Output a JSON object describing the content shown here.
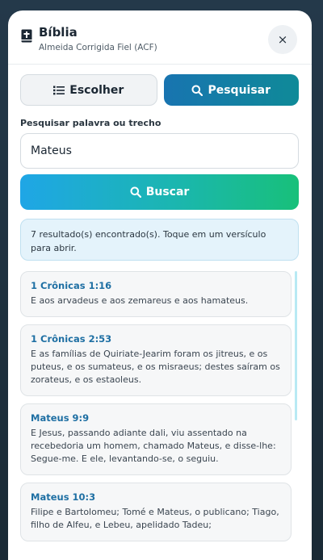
{
  "header": {
    "title": "Bíblia",
    "subtitle": "Almeida Corrigida Fiel (ACF)",
    "close_label": "×"
  },
  "tabs": {
    "choose_label": "Escolher",
    "search_label": "Pesquisar",
    "active": "Pesquisar"
  },
  "search": {
    "label": "Pesquisar palavra ou trecho",
    "value": "Mateus",
    "button_label": "Buscar"
  },
  "info": {
    "message": "7 resultado(s) encontrado(s). Toque em um versículo para abrir."
  },
  "results": [
    {
      "ref": "1 Crônicas 1:16",
      "text": "E aos arvadeus e aos zemareus e aos hamateus."
    },
    {
      "ref": "1 Crônicas 2:53",
      "text": "E as famílias de Quiriate-Jearim foram os jitreus, e os puteus, e os sumateus, e os misraeus; destes saíram os zorateus, e os estaoleus."
    },
    {
      "ref": "Mateus 9:9",
      "text": "E Jesus, passando adiante dali, viu assentado na recebedoria um homem, chamado Mateus, e disse-lhe: Segue-me. E ele, levantando-se, o seguiu."
    },
    {
      "ref": "Mateus 10:3",
      "text": "Filipe e Bartolomeu; Tomé e Mateus, o publicano; Tiago, filho de Alfeu, e Lebeu, apelidado Tadeu;"
    }
  ],
  "colors": {
    "accent": "#1874b0",
    "search_gradient_start": "#1fa6e6",
    "search_gradient_end": "#18c07a",
    "ref_text": "#1e6fa3"
  }
}
